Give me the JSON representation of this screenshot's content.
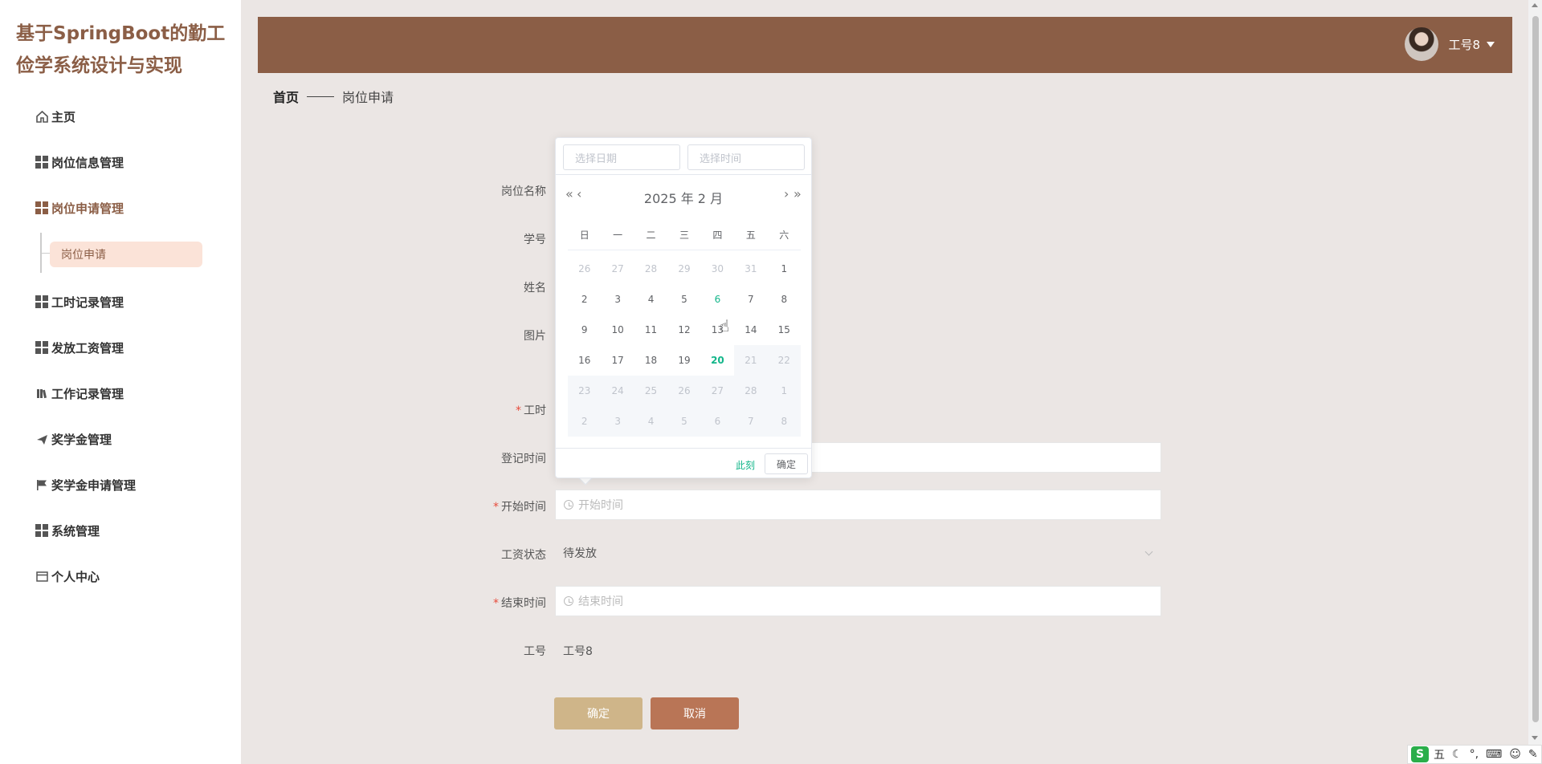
{
  "app": {
    "title": "基于SpringBoot的勤工俭学系统设计与实现"
  },
  "sidebar": {
    "items": [
      {
        "label": "主页",
        "icon": "home-icon"
      },
      {
        "label": "岗位信息管理",
        "icon": "grid-icon"
      },
      {
        "label": "岗位申请管理",
        "icon": "grid-icon",
        "active": true
      },
      {
        "label": "工时记录管理",
        "icon": "grid-icon"
      },
      {
        "label": "发放工资管理",
        "icon": "grid-icon"
      },
      {
        "label": "工作记录管理",
        "icon": "book-icon"
      },
      {
        "label": "奖学金管理",
        "icon": "paper-plane-icon"
      },
      {
        "label": "奖学金申请管理",
        "icon": "flag-icon"
      },
      {
        "label": "系统管理",
        "icon": "grid-icon"
      },
      {
        "label": "个人中心",
        "icon": "calendar-icon"
      }
    ],
    "submenu": {
      "label": "岗位申请"
    }
  },
  "header": {
    "username": "工号8"
  },
  "breadcrumb": {
    "home": "首页",
    "current": "岗位申请"
  },
  "form": {
    "labels": {
      "job_name": "岗位名称",
      "student_id": "学号",
      "name": "姓名",
      "image": "图片",
      "hours": "工时",
      "register_time": "登记时间",
      "start_time": "开始时间",
      "salary_status": "工资状态",
      "end_time": "结束时间",
      "work_id": "工号"
    },
    "start_time_placeholder": "开始时间",
    "salary_status_value": "待发放",
    "end_time_placeholder": "结束时间",
    "work_id_value": "工号8",
    "ok_label": "确定",
    "cancel_label": "取消"
  },
  "datepicker": {
    "date_placeholder": "选择日期",
    "time_placeholder": "选择时间",
    "header": "2025 年  2 月",
    "weekdays": [
      "日",
      "一",
      "二",
      "三",
      "四",
      "五",
      "六"
    ],
    "days": [
      [
        "26",
        "27",
        "28",
        "29",
        "30",
        "31",
        "1"
      ],
      [
        "2",
        "3",
        "4",
        "5",
        "6",
        "7",
        "8"
      ],
      [
        "9",
        "10",
        "11",
        "12",
        "13",
        "14",
        "15"
      ],
      [
        "16",
        "17",
        "18",
        "19",
        "20",
        "21",
        "22"
      ],
      [
        "23",
        "24",
        "25",
        "26",
        "27",
        "28",
        "1"
      ],
      [
        "2",
        "3",
        "4",
        "5",
        "6",
        "7",
        "8"
      ]
    ],
    "now_label": "此刻",
    "ok_label": "确定"
  },
  "ime": {
    "label": "五"
  },
  "colors": {
    "brand": "#8b5e46",
    "accent": "#13b68a",
    "ok_button": "#cfb589",
    "cancel_button": "#b97556"
  }
}
